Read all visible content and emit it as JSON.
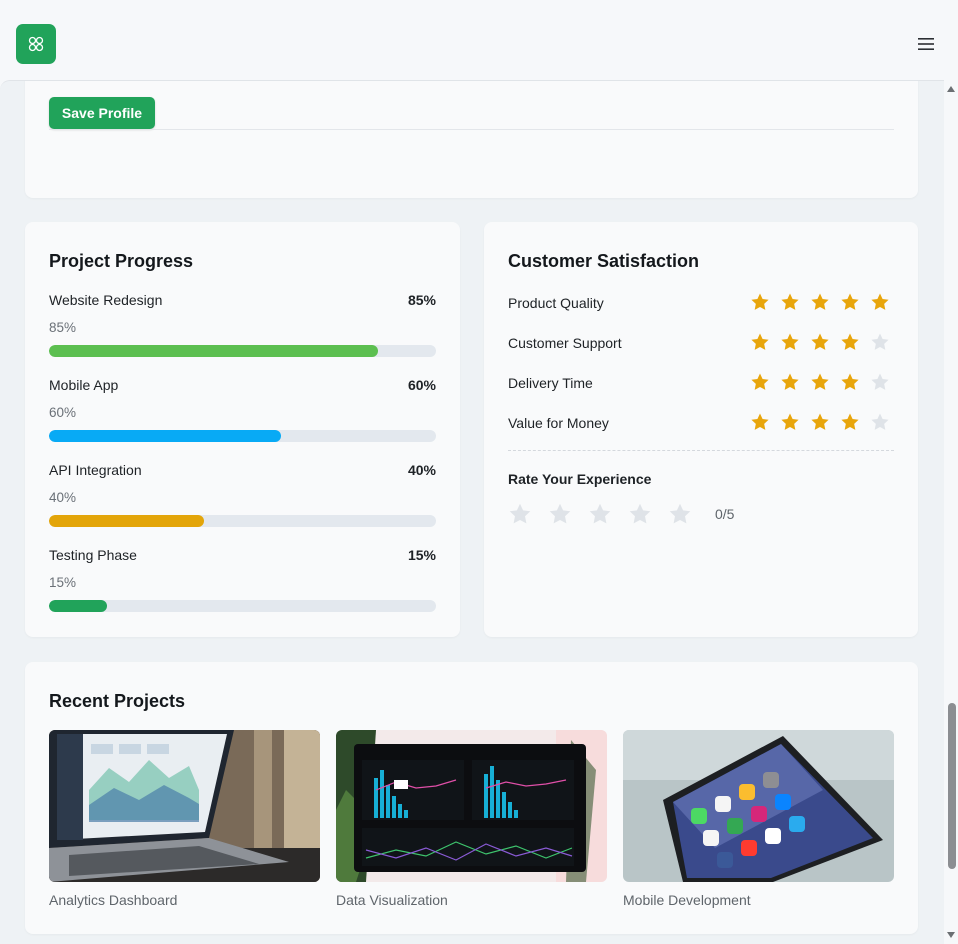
{
  "header": {
    "logo_icon": "grid-icon",
    "menu_icon": "hamburger-menu-icon",
    "brand_color": "#21a35a"
  },
  "profile": {
    "save_label": "Save Profile"
  },
  "progress": {
    "title": "Project Progress",
    "items": [
      {
        "name": "Website Redesign",
        "percent_label": "85%",
        "value": 85,
        "color": "#5cbf50"
      },
      {
        "name": "Mobile App",
        "percent_label": "60%",
        "value": 60,
        "color": "#08aaf5"
      },
      {
        "name": "API Integration",
        "percent_label": "40%",
        "value": 40,
        "color": "#e3a509"
      },
      {
        "name": "Testing Phase",
        "percent_label": "15%",
        "value": 15,
        "color": "#21a35a"
      }
    ]
  },
  "satisfaction": {
    "title": "Customer Satisfaction",
    "star_color": "#e8a50c",
    "empty_star_color": "#dfe3e8",
    "ratings": [
      {
        "label": "Product Quality",
        "stars": 5,
        "max": 5
      },
      {
        "label": "Customer Support",
        "stars": 4,
        "max": 5
      },
      {
        "label": "Delivery Time",
        "stars": 4,
        "max": 5
      },
      {
        "label": "Value for Money",
        "stars": 4,
        "max": 5
      }
    ],
    "rate_title": "Rate Your Experience",
    "rate_count": "0/5",
    "rate_value": 0
  },
  "projects": {
    "title": "Recent Projects",
    "items": [
      {
        "caption": "Analytics Dashboard",
        "image": "laptop-analytics-photo"
      },
      {
        "caption": "Data Visualization",
        "image": "monitor-charts-photo"
      },
      {
        "caption": "Mobile Development",
        "image": "smartphone-apps-photo"
      }
    ]
  }
}
